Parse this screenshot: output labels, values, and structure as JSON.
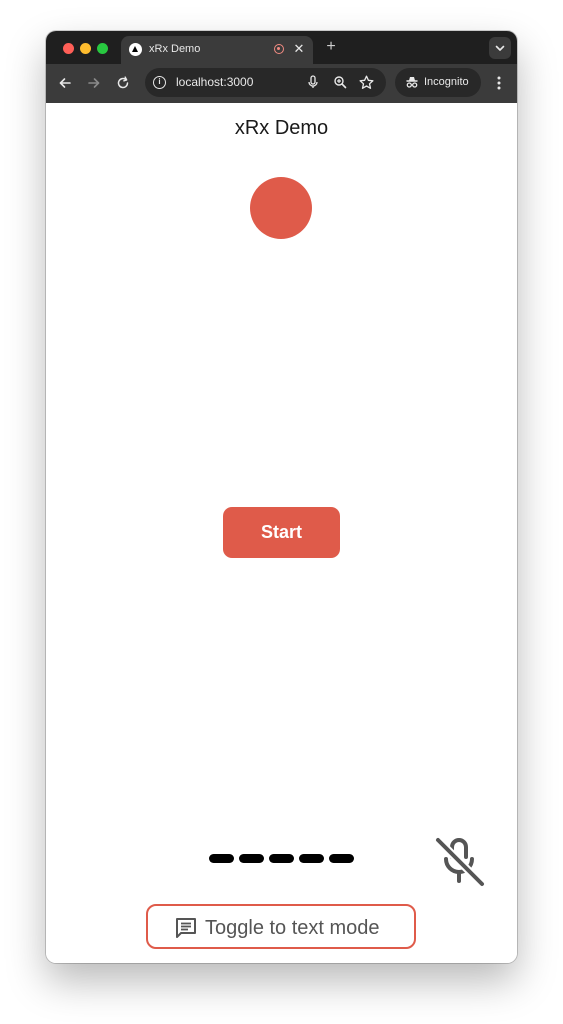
{
  "browser": {
    "tab": {
      "title": "xRx Demo",
      "favicon": "triangle-logo-icon"
    },
    "address": {
      "url": "localhost:3000"
    },
    "profile": {
      "label": "Incognito"
    }
  },
  "app": {
    "title": "xRx Demo",
    "status_indicator_color": "#df5b4a",
    "start_label": "Start",
    "toggle_label": "Toggle to text mode",
    "mic_state": "muted"
  },
  "colors": {
    "accent": "#df5b4a",
    "tab_bar": "#1f1f1f",
    "toolbar": "#3b3b3b"
  }
}
